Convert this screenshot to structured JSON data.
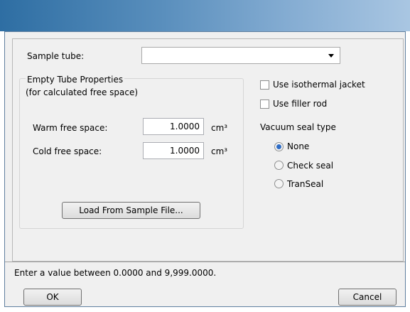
{
  "sample_tube": {
    "label": "Sample tube:",
    "value": ""
  },
  "empty_tube": {
    "title": "Empty Tube Properties",
    "subtitle": "(for calculated free space)",
    "warm_label": "Warm free space:",
    "warm_value": "1.0000",
    "cold_label": "Cold free space:",
    "cold_value": "1.0000",
    "unit": "cm³",
    "load_button": "Load From Sample File..."
  },
  "options": {
    "isothermal_jacket": "Use isothermal jacket",
    "isothermal_jacket_checked": false,
    "filler_rod": "Use filler rod",
    "filler_rod_checked": false
  },
  "vacuum_seal": {
    "title": "Vacuum seal type",
    "options": [
      "None",
      "Check seal",
      "TranSeal"
    ],
    "selected": "None"
  },
  "status": "Enter a value between 0.0000 and 9,999.0000.",
  "buttons": {
    "ok": "OK",
    "cancel": "Cancel"
  },
  "colors": {
    "titlebar": "#5a8fbd",
    "radio_selected": "#2e6cc5"
  }
}
